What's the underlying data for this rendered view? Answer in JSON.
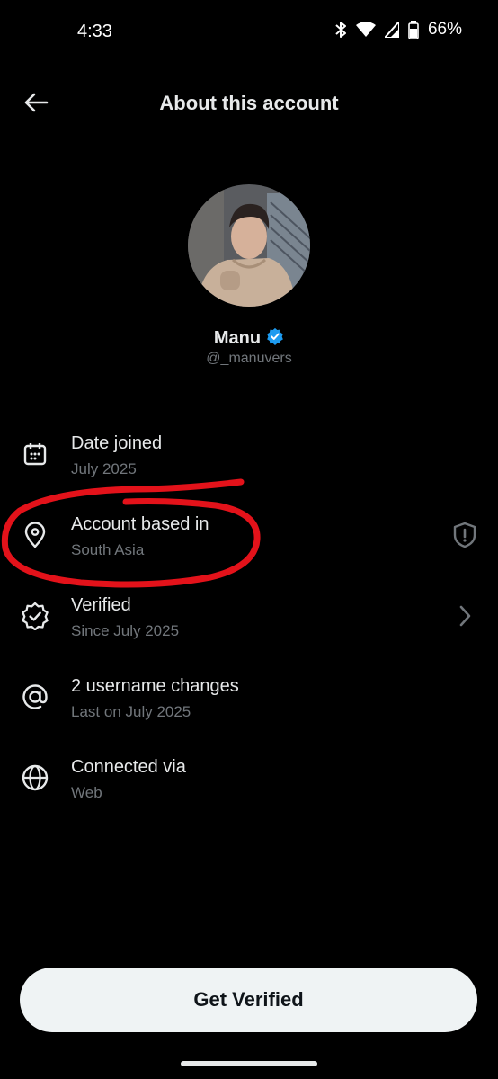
{
  "status_bar": {
    "time": "4:33",
    "battery": "66%",
    "icons": [
      "bluetooth-icon",
      "wifi-icon",
      "signal-icon",
      "battery-icon"
    ]
  },
  "header": {
    "title": "About this account",
    "back_icon": "arrow-left-icon"
  },
  "profile": {
    "name": "Manu",
    "handle": "@_manuvers",
    "verified_badge_color": "#1d9bf0"
  },
  "info_rows": [
    {
      "icon": "calendar-icon",
      "title": "Date joined",
      "subtitle": "July 2025"
    },
    {
      "icon": "location-pin-icon",
      "title": "Account based in",
      "subtitle": "South Asia",
      "trailing_icon": "shield-alert-icon"
    },
    {
      "icon": "verified-outline-icon",
      "title": "Verified",
      "subtitle": "Since July 2025",
      "trailing_icon": "chevron-right-icon"
    },
    {
      "icon": "at-sign-icon",
      "title": "2 username changes",
      "subtitle": "Last on July 2025"
    },
    {
      "icon": "globe-icon",
      "title": "Connected via",
      "subtitle": "Web"
    }
  ],
  "annotation_color": "#e3121a",
  "actions": {
    "get_verified_label": "Get Verified"
  },
  "colors": {
    "background": "#000000",
    "primary_text": "#e7e9ea",
    "secondary_text": "#71767b",
    "button_bg": "#eff3f4"
  }
}
